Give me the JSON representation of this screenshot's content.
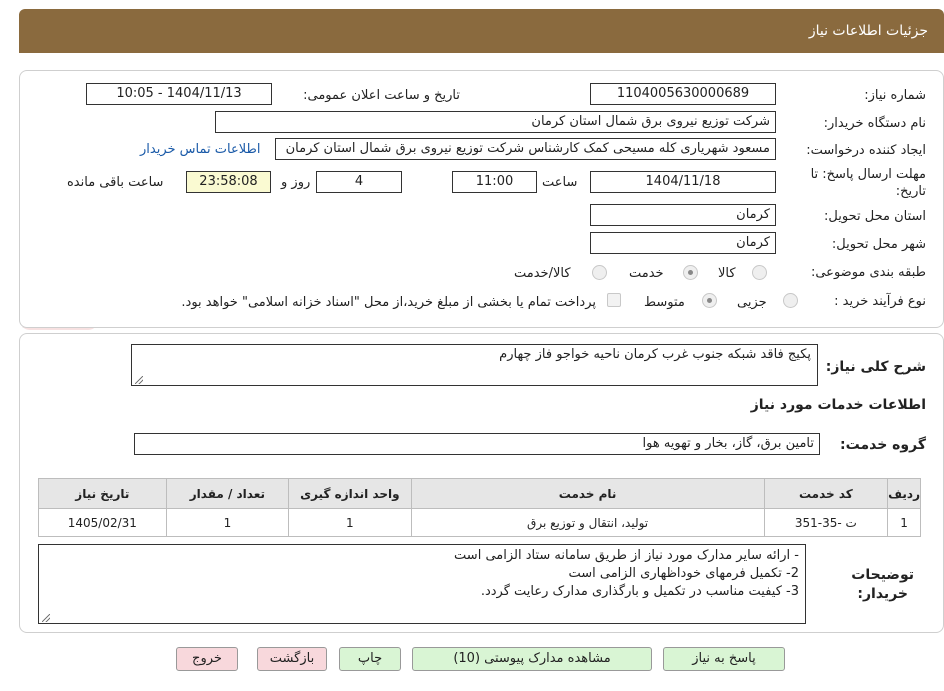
{
  "header": {
    "title": "جزئیات اطلاعات نیاز"
  },
  "form": {
    "need_number": {
      "label": "شماره نیاز:",
      "value": "1104005630000689"
    },
    "announce": {
      "label": "تاریخ و ساعت اعلان عمومی:",
      "value": "1404/11/13 - 10:05"
    },
    "buyer_org": {
      "label": "نام دستگاه خریدار:",
      "value": "شرکت توزیع نیروی برق شمال استان کرمان"
    },
    "requester": {
      "label": "ایجاد کننده درخواست:",
      "value": "مسعود شهریاری کله مسیحی کمک کارشناس شرکت توزیع نیروی برق شمال استان کرمان",
      "contact_link": "اطلاعات تماس خریدار"
    },
    "deadline": {
      "label_line1": "مهلت ارسال پاسخ: تا",
      "label_line2": "تاریخ:",
      "date": "1404/11/18",
      "time_label": "ساعت",
      "time": "11:00",
      "days": "4",
      "days_label": "روز و",
      "remaining": "23:58:08",
      "remaining_label": "ساعت باقی مانده"
    },
    "delivery_province": {
      "label": "استان محل تحویل:",
      "value": "کرمان"
    },
    "delivery_city": {
      "label": "شهر محل تحویل:",
      "value": "کرمان"
    },
    "category": {
      "label": "طبقه بندی موضوعی:",
      "options": [
        "کالا",
        "خدمت",
        "کالا/خدمت"
      ],
      "selected": "خدمت"
    },
    "purchase_type": {
      "label": "نوع فرآیند خرید :",
      "options": [
        "جزیی",
        "متوسط"
      ],
      "selected": "متوسط",
      "note": "پرداخت تمام یا بخشی از مبلغ خرید،از محل \"اسناد خزانه اسلامی\" خواهد بود."
    }
  },
  "watermark": {
    "text": "AriaTender.neT"
  },
  "details": {
    "description_label": "شرح کلی نیاز:",
    "description": "پکیج فاقد شبکه جنوب غرب کرمان ناحیه خواجو فاز چهارم",
    "services_title": "اطلاعات خدمات مورد نیاز",
    "service_group_label": "گروه خدمت:",
    "service_group": "تامین برق، گاز، بخار و تهویه هوا",
    "table": {
      "headers": [
        "ردیف",
        "کد خدمت",
        "نام خدمت",
        "واحد اندازه گیری",
        "تعداد / مقدار",
        "تاریخ نیاز"
      ],
      "rows": [
        [
          "1",
          "ت -35-351",
          "تولید، انتقال و توزیع برق",
          "1",
          "1",
          "1405/02/31"
        ]
      ]
    },
    "buyer_notes_label_1": "توضیحات",
    "buyer_notes_label_2": "خریدار:",
    "buyer_notes": [
      "- ارائه سایر مدارک مورد نیاز از طریق سامانه ستاد الزامی است",
      "2- تکمیل فرمهای خوداظهاری الزامی است",
      "3- کیفیت مناسب در تکمیل و بارگذاری مدارک رعایت گردد."
    ]
  },
  "buttons": {
    "reply": "پاسخ به نیاز",
    "attachments": "مشاهده مدارک پیوستی (10)",
    "print": "چاپ",
    "back": "بازگشت",
    "exit": "خروج"
  }
}
